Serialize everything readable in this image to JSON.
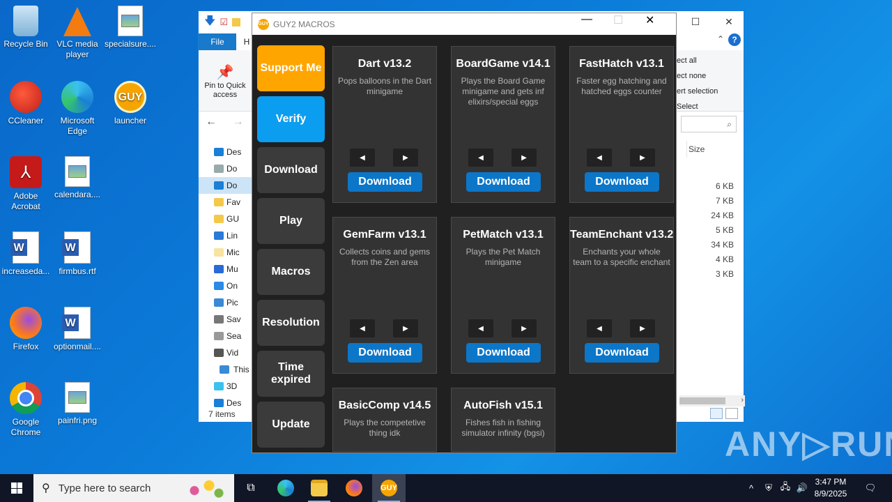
{
  "desktop_icons": [
    {
      "label": "Recycle Bin",
      "icon": "recycle-bin-icon"
    },
    {
      "label": "VLC media player",
      "icon": "vlc-icon"
    },
    {
      "label": "specialsure....",
      "icon": "image-file-icon"
    },
    {
      "label": "CCleaner",
      "icon": "ccleaner-icon"
    },
    {
      "label": "Microsoft Edge",
      "icon": "edge-icon"
    },
    {
      "label": "launcher",
      "icon": "guy-launcher-icon"
    },
    {
      "label": "Adobe Acrobat",
      "icon": "acrobat-icon"
    },
    {
      "label": "calendara....",
      "icon": "image-file-icon"
    },
    {
      "label": "increaseda...",
      "icon": "word-file-icon"
    },
    {
      "label": "firmbus.rtf",
      "icon": "word-file-icon"
    },
    {
      "label": "Firefox",
      "icon": "firefox-icon"
    },
    {
      "label": "optionmail....",
      "icon": "word-file-icon"
    },
    {
      "label": "Google Chrome",
      "icon": "chrome-icon"
    },
    {
      "label": "painfri.png",
      "icon": "image-file-icon"
    }
  ],
  "explorer": {
    "tab_file": "File",
    "tab_home": "H",
    "pin_label": "Pin to Quick access",
    "select_all": "ect all",
    "select_none": "ect none",
    "invert_selection": "ert selection",
    "select_group": "Select",
    "tree": [
      "Des",
      "Do",
      "Do",
      "Fav",
      "GU",
      "Lin",
      "Mic",
      "Mu",
      "On",
      "Pic",
      "Sav",
      "Sea",
      "Vid",
      "This",
      "3D",
      "Des"
    ],
    "column_size": "Size",
    "sizes": [
      "6 KB",
      "7 KB",
      "24 KB",
      "5 KB",
      "34 KB",
      "4 KB",
      "3 KB"
    ],
    "status": "7 items"
  },
  "macro_app": {
    "title": "GUY2 MACROS",
    "logo_text": "GUY",
    "sidebar": [
      {
        "label": "Support Me",
        "style": "orange"
      },
      {
        "label": "Verify",
        "style": "blue"
      },
      {
        "label": "Download",
        "style": "dark"
      },
      {
        "label": "Play",
        "style": "dark"
      },
      {
        "label": "Macros",
        "style": "dark"
      },
      {
        "label": "Resolution",
        "style": "dark"
      },
      {
        "label": "Time expired",
        "style": "dark"
      },
      {
        "label": "Update",
        "style": "dark"
      }
    ],
    "cards": [
      {
        "name": "Dart v13.2",
        "desc": "Pops balloons in the Dart minigame",
        "button": "Download"
      },
      {
        "name": "BoardGame v14.1",
        "desc": "Plays the Board Game minigame and gets inf elixirs/special eggs",
        "button": "Download"
      },
      {
        "name": "FastHatch v13.1",
        "desc": "Faster egg hatching and hatched eggs counter",
        "button": "Download"
      },
      {
        "name": "GemFarm v13.1",
        "desc": "Collects coins and gems from the Zen area",
        "button": "Download"
      },
      {
        "name": "PetMatch v13.1",
        "desc": "Plays the Pet Match minigame",
        "button": "Download"
      },
      {
        "name": "TeamEnchant v13.2",
        "desc": "Enchants your whole team to a specific enchant",
        "button": "Download"
      },
      {
        "name": "BasicComp v14.5",
        "desc": "Plays the competetive thing idk",
        "button": ""
      },
      {
        "name": "AutoFish v15.1",
        "desc": "Fishes fish in fishing simulator infinity (bgsi)",
        "button": ""
      }
    ],
    "arrow_left": "◀",
    "arrow_right": "▶"
  },
  "watermark": "ANY▷RUN",
  "taskbar": {
    "search_placeholder": "Type here to search",
    "time": "3:47 PM",
    "date": "8/9/2025"
  }
}
